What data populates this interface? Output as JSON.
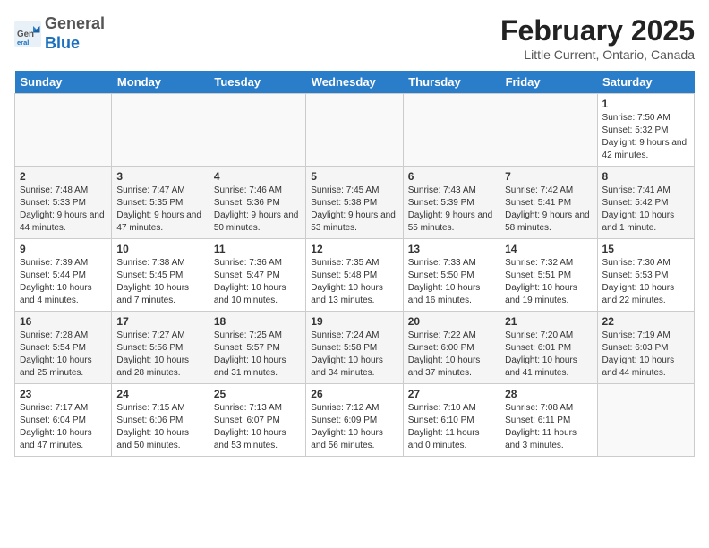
{
  "header": {
    "logo_general": "General",
    "logo_blue": "Blue",
    "month_title": "February 2025",
    "location": "Little Current, Ontario, Canada"
  },
  "days_of_week": [
    "Sunday",
    "Monday",
    "Tuesday",
    "Wednesday",
    "Thursday",
    "Friday",
    "Saturday"
  ],
  "weeks": [
    [
      {
        "day": "",
        "info": ""
      },
      {
        "day": "",
        "info": ""
      },
      {
        "day": "",
        "info": ""
      },
      {
        "day": "",
        "info": ""
      },
      {
        "day": "",
        "info": ""
      },
      {
        "day": "",
        "info": ""
      },
      {
        "day": "1",
        "info": "Sunrise: 7:50 AM\nSunset: 5:32 PM\nDaylight: 9 hours and 42 minutes."
      }
    ],
    [
      {
        "day": "2",
        "info": "Sunrise: 7:48 AM\nSunset: 5:33 PM\nDaylight: 9 hours and 44 minutes."
      },
      {
        "day": "3",
        "info": "Sunrise: 7:47 AM\nSunset: 5:35 PM\nDaylight: 9 hours and 47 minutes."
      },
      {
        "day": "4",
        "info": "Sunrise: 7:46 AM\nSunset: 5:36 PM\nDaylight: 9 hours and 50 minutes."
      },
      {
        "day": "5",
        "info": "Sunrise: 7:45 AM\nSunset: 5:38 PM\nDaylight: 9 hours and 53 minutes."
      },
      {
        "day": "6",
        "info": "Sunrise: 7:43 AM\nSunset: 5:39 PM\nDaylight: 9 hours and 55 minutes."
      },
      {
        "day": "7",
        "info": "Sunrise: 7:42 AM\nSunset: 5:41 PM\nDaylight: 9 hours and 58 minutes."
      },
      {
        "day": "8",
        "info": "Sunrise: 7:41 AM\nSunset: 5:42 PM\nDaylight: 10 hours and 1 minute."
      }
    ],
    [
      {
        "day": "9",
        "info": "Sunrise: 7:39 AM\nSunset: 5:44 PM\nDaylight: 10 hours and 4 minutes."
      },
      {
        "day": "10",
        "info": "Sunrise: 7:38 AM\nSunset: 5:45 PM\nDaylight: 10 hours and 7 minutes."
      },
      {
        "day": "11",
        "info": "Sunrise: 7:36 AM\nSunset: 5:47 PM\nDaylight: 10 hours and 10 minutes."
      },
      {
        "day": "12",
        "info": "Sunrise: 7:35 AM\nSunset: 5:48 PM\nDaylight: 10 hours and 13 minutes."
      },
      {
        "day": "13",
        "info": "Sunrise: 7:33 AM\nSunset: 5:50 PM\nDaylight: 10 hours and 16 minutes."
      },
      {
        "day": "14",
        "info": "Sunrise: 7:32 AM\nSunset: 5:51 PM\nDaylight: 10 hours and 19 minutes."
      },
      {
        "day": "15",
        "info": "Sunrise: 7:30 AM\nSunset: 5:53 PM\nDaylight: 10 hours and 22 minutes."
      }
    ],
    [
      {
        "day": "16",
        "info": "Sunrise: 7:28 AM\nSunset: 5:54 PM\nDaylight: 10 hours and 25 minutes."
      },
      {
        "day": "17",
        "info": "Sunrise: 7:27 AM\nSunset: 5:56 PM\nDaylight: 10 hours and 28 minutes."
      },
      {
        "day": "18",
        "info": "Sunrise: 7:25 AM\nSunset: 5:57 PM\nDaylight: 10 hours and 31 minutes."
      },
      {
        "day": "19",
        "info": "Sunrise: 7:24 AM\nSunset: 5:58 PM\nDaylight: 10 hours and 34 minutes."
      },
      {
        "day": "20",
        "info": "Sunrise: 7:22 AM\nSunset: 6:00 PM\nDaylight: 10 hours and 37 minutes."
      },
      {
        "day": "21",
        "info": "Sunrise: 7:20 AM\nSunset: 6:01 PM\nDaylight: 10 hours and 41 minutes."
      },
      {
        "day": "22",
        "info": "Sunrise: 7:19 AM\nSunset: 6:03 PM\nDaylight: 10 hours and 44 minutes."
      }
    ],
    [
      {
        "day": "23",
        "info": "Sunrise: 7:17 AM\nSunset: 6:04 PM\nDaylight: 10 hours and 47 minutes."
      },
      {
        "day": "24",
        "info": "Sunrise: 7:15 AM\nSunset: 6:06 PM\nDaylight: 10 hours and 50 minutes."
      },
      {
        "day": "25",
        "info": "Sunrise: 7:13 AM\nSunset: 6:07 PM\nDaylight: 10 hours and 53 minutes."
      },
      {
        "day": "26",
        "info": "Sunrise: 7:12 AM\nSunset: 6:09 PM\nDaylight: 10 hours and 56 minutes."
      },
      {
        "day": "27",
        "info": "Sunrise: 7:10 AM\nSunset: 6:10 PM\nDaylight: 11 hours and 0 minutes."
      },
      {
        "day": "28",
        "info": "Sunrise: 7:08 AM\nSunset: 6:11 PM\nDaylight: 11 hours and 3 minutes."
      },
      {
        "day": "",
        "info": ""
      }
    ]
  ]
}
